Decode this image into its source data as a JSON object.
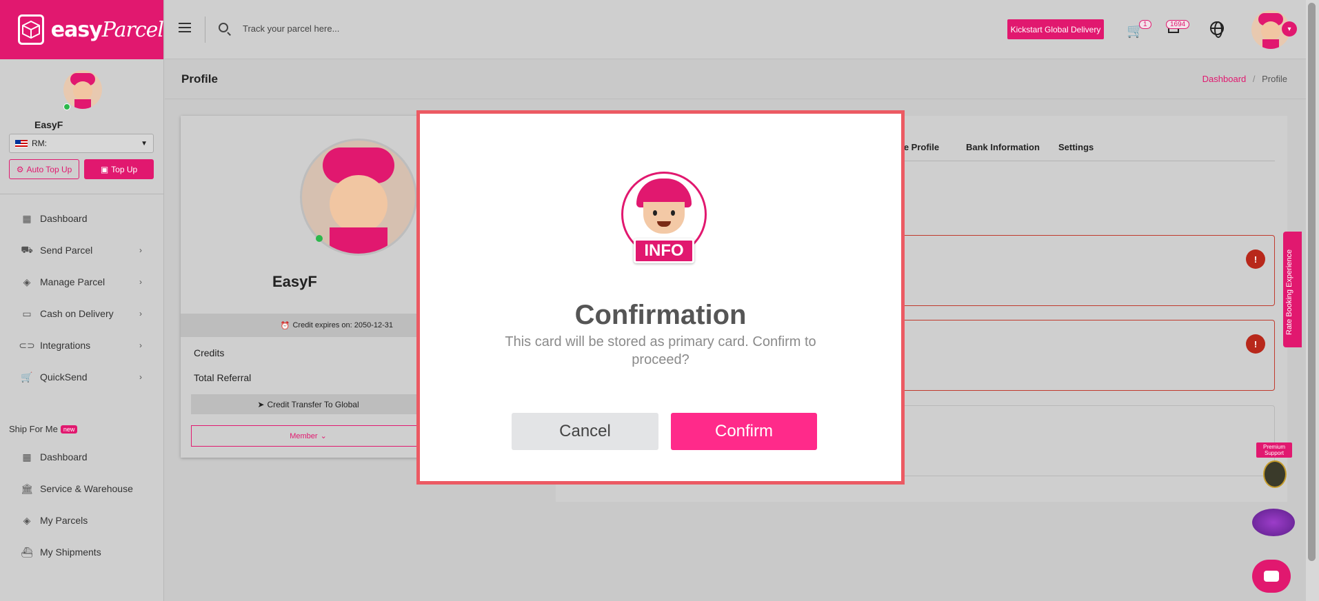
{
  "brand": {
    "logo_text": "easy",
    "logo_script": "Parcel",
    "accent": "#e1186f"
  },
  "sidebar": {
    "user_name": "EasyF",
    "currency": "RM:",
    "auto_topup_label": "Auto Top Up",
    "topup_label": "Top Up",
    "items": [
      {
        "label": "Dashboard",
        "icon": "dashboard-icon"
      },
      {
        "label": "Send Parcel",
        "icon": "truck-icon"
      },
      {
        "label": "Manage Parcel",
        "icon": "boxes-icon"
      },
      {
        "label": "Cash on Delivery",
        "icon": "cash-icon"
      },
      {
        "label": "Integrations",
        "icon": "link-icon"
      },
      {
        "label": "QuickSend",
        "icon": "cart-icon"
      }
    ],
    "ship_for_me": {
      "label": "Ship For Me",
      "badge": "new",
      "items": [
        {
          "label": "Dashboard",
          "icon": "dashboard-icon"
        },
        {
          "label": "Service & Warehouse",
          "icon": "warehouse-icon"
        },
        {
          "label": "My Parcels",
          "icon": "boxes-icon"
        },
        {
          "label": "My Shipments",
          "icon": "ship-icon"
        }
      ]
    }
  },
  "topbar": {
    "search_placeholder": "Track your parcel here...",
    "kickstart_label": "Kickstart Global Delivery",
    "cart_count": "1",
    "notification_count": "1694"
  },
  "page": {
    "title": "Profile",
    "breadcrumb": {
      "parent": "Dashboard",
      "separator": "/",
      "current": "Profile"
    }
  },
  "profile_card": {
    "name": "EasyF",
    "credit_expiry": "Credit expires on: 2050-12-31",
    "credits_label": "Credits",
    "referral_label": "Total Referral",
    "transfer_label": "Credit Transfer To Global",
    "member_label": "Member"
  },
  "tabs": [
    "ice Profile",
    "Bank Information",
    "Settings"
  ],
  "side_tab_label": "Rate Booking Experience",
  "premium_support_label": "Premium Support",
  "modal": {
    "badge_text": "INFO",
    "title": "Confirmation",
    "message": "This card will be stored as primary card. Confirm to proceed?",
    "cancel_label": "Cancel",
    "confirm_label": "Confirm"
  }
}
